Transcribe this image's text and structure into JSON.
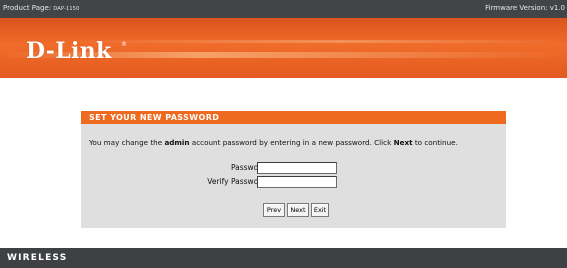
{
  "topbar": {
    "product_label": "Product Page:",
    "model": "DAP-1150",
    "firmware": "Firmware Version: v1.0"
  },
  "banner": {
    "logo_text": "D-Link",
    "reg_mark": "®"
  },
  "panel": {
    "title": "SET YOUR NEW PASSWORD",
    "desc_part1": "You may change the ",
    "desc_bold1": "admin",
    "desc_part2": " account password by entering in a new password. Click ",
    "desc_bold2": "Next",
    "desc_part3": " to continue.",
    "password_label": "Password",
    "verify_label": "Verify Password",
    "password_value": "",
    "verify_value": ""
  },
  "buttons": {
    "prev": "Prev",
    "next": "Next",
    "exit": "Exit"
  },
  "footer": {
    "label": "WIRELESS"
  },
  "colors": {
    "accent_orange": "#ee6a1f",
    "topbar_gray": "#424448",
    "panel_gray": "#dfdfdf"
  }
}
